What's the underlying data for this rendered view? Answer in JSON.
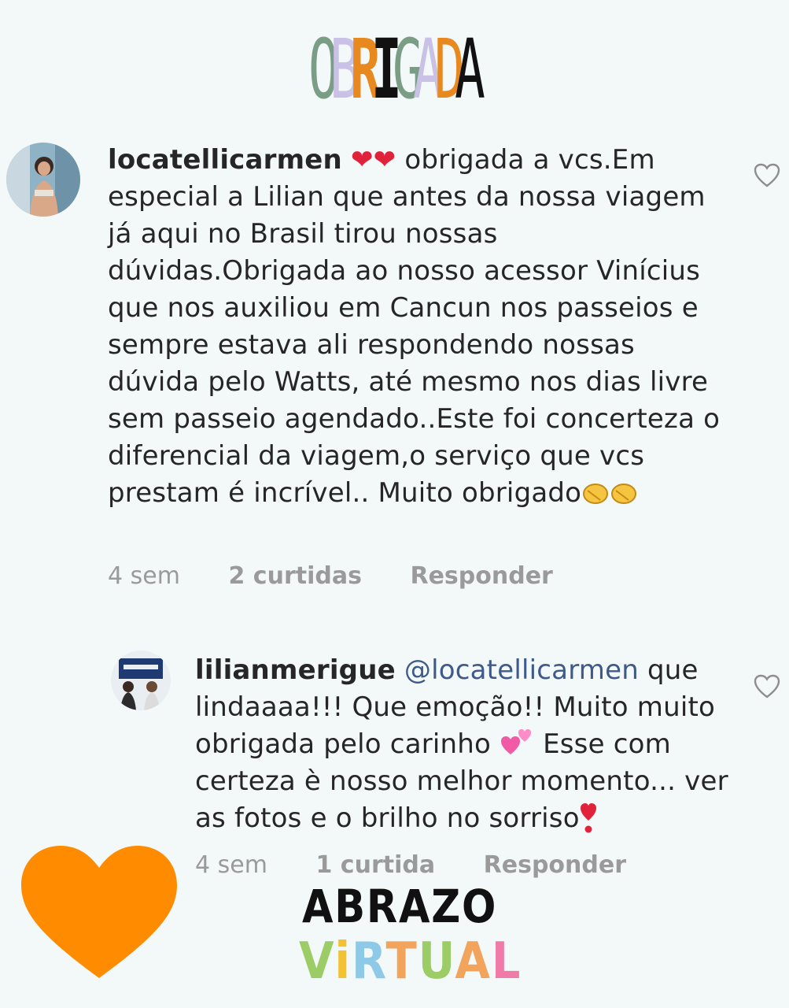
{
  "header": {
    "title_letters": [
      "O",
      "B",
      "R",
      "I",
      "G",
      "A",
      "D",
      "A"
    ],
    "title_colors": [
      "#7a9e85",
      "#c9c1e6",
      "#e8891f",
      "#111111",
      "#7a9e85",
      "#c9c1e6",
      "#e8891f",
      "#111111"
    ]
  },
  "comments": [
    {
      "username": "locatellicarmen",
      "emoji_hearts": "❤❤",
      "body_1": " obrigada a vcs.Em especial a Lilian que antes da nossa viagem já aqui no Brasil tirou nossas dúvidas.Obrigada ao nosso acessor Vinícius que nos auxiliou em Cancun nos passeios e sempre estava ali respondendo nossas dúvida pelo Watts, até mesmo nos dias livre sem passeio agendado..Este foi concerteza o diferencial da viagem,o serviço que vcs prestam é incrível.. Muito obrigado",
      "time": "4 sem",
      "likes": "2 curtidas",
      "reply": "Responder"
    },
    {
      "username": "lilianmerigue",
      "mention": "@locatellicarmen",
      "body_1": " que lindaaaa!!! Que emoção!! Muito muito obrigada pelo carinho ",
      "body_2": " Esse com certeza è nosso melhor momento... ver as fotos e o brilho no sorriso",
      "time": "4 sem",
      "likes": "1 curtida",
      "reply": "Responder"
    }
  ],
  "sticker": {
    "line1": "ABRAZO",
    "line2_letters": [
      "V",
      "i",
      "R",
      "T",
      "U",
      "A",
      "L"
    ],
    "line2_colors": [
      "#9ccc65",
      "#f2c230",
      "#8fc9e8",
      "#f2a35c",
      "#9ccc65",
      "#f2a35c",
      "#f07aa8"
    ]
  },
  "colors": {
    "heart_orange": "#ff8c00",
    "text": "#262626",
    "meta": "#9a9a9a",
    "mention": "#3f5a8a"
  }
}
